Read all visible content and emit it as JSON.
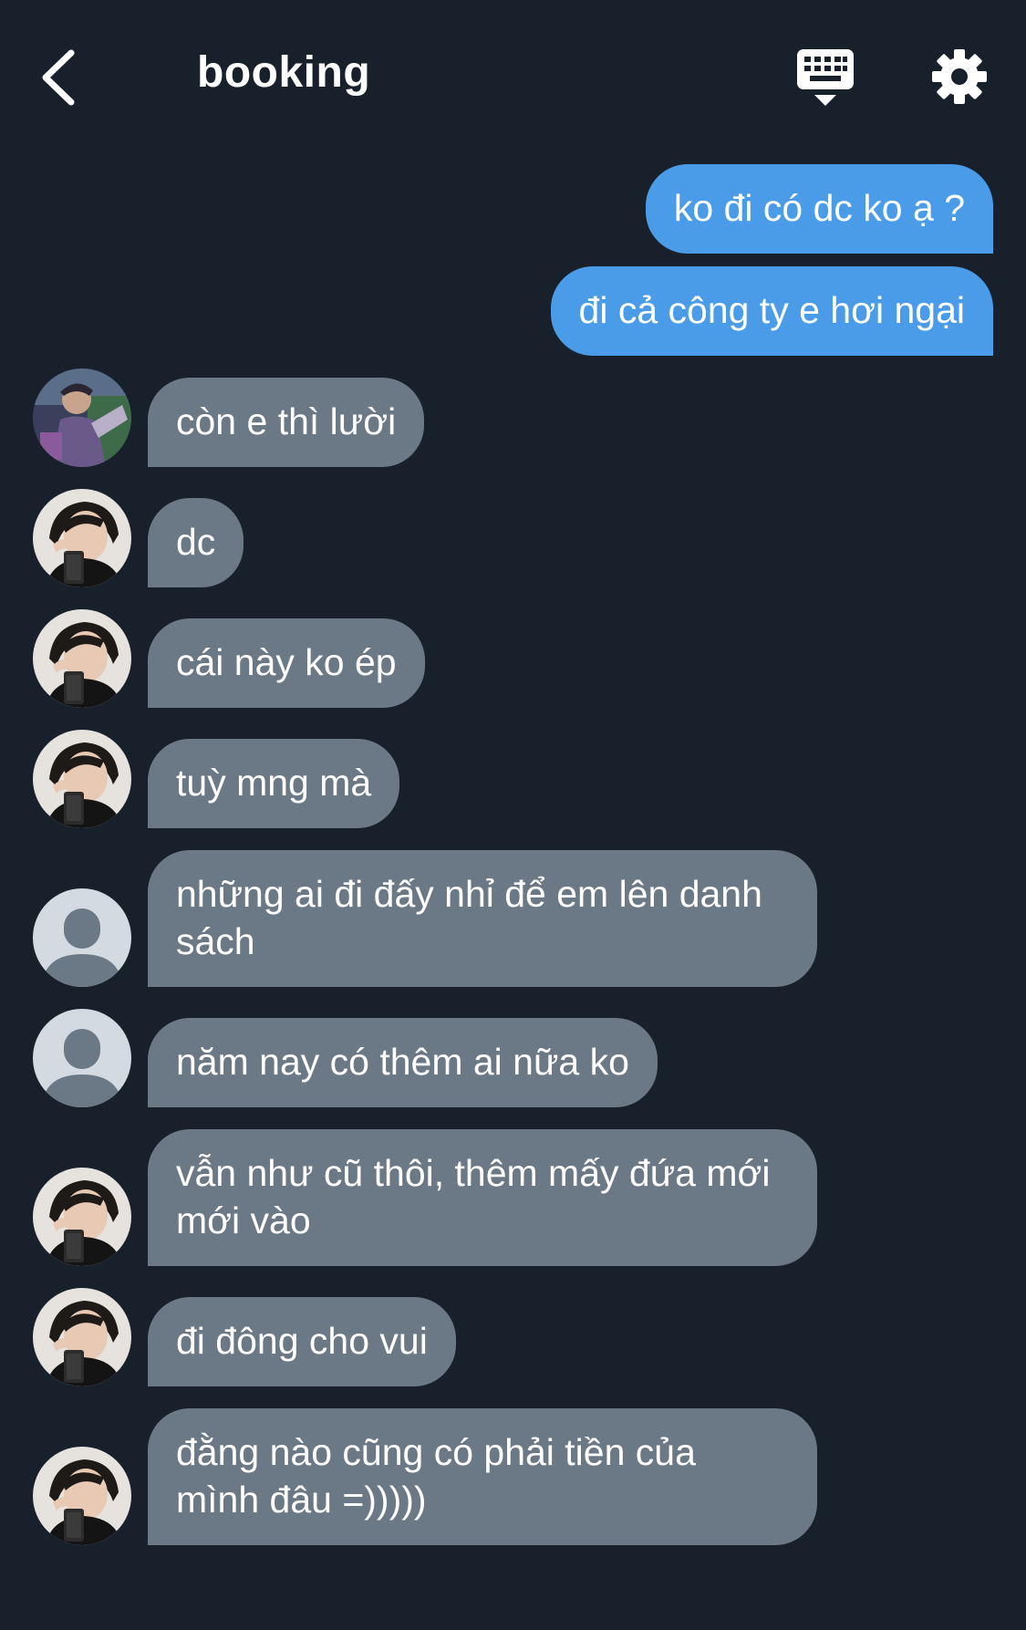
{
  "header": {
    "title": "booking",
    "back_icon": "chevron-left-icon",
    "keyboard_icon": "keyboard-icon",
    "settings_icon": "gear-icon"
  },
  "colors": {
    "background": "#18202b",
    "outgoing_bubble": "#4a9ce8",
    "incoming_bubble": "#6b7886",
    "text": "#ffffff"
  },
  "messages": [
    {
      "direction": "out",
      "text": "ko đi có dc ko ạ ?"
    },
    {
      "direction": "out",
      "text": "đi cả công ty e hơi ngại"
    },
    {
      "direction": "in",
      "avatar": "photo-avatar-a",
      "text": "còn e thì lười"
    },
    {
      "direction": "in",
      "avatar": "photo-avatar-b",
      "text": "dc"
    },
    {
      "direction": "in",
      "avatar": "photo-avatar-b",
      "text": "cái này ko ép"
    },
    {
      "direction": "in",
      "avatar": "photo-avatar-b",
      "text": "tuỳ mng mà"
    },
    {
      "direction": "in",
      "avatar": "default-avatar",
      "text": "những ai đi đấy nhỉ để em lên danh sách"
    },
    {
      "direction": "in",
      "avatar": "default-avatar",
      "text": "năm nay có thêm ai nữa ko"
    },
    {
      "direction": "in",
      "avatar": "photo-avatar-b",
      "text": "vẫn như cũ thôi, thêm mấy đứa mới mới vào"
    },
    {
      "direction": "in",
      "avatar": "photo-avatar-b",
      "text": "đi đông cho vui"
    },
    {
      "direction": "in",
      "avatar": "photo-avatar-b",
      "text": "đằng nào cũng có phải tiền của mình đâu =)))))"
    }
  ]
}
